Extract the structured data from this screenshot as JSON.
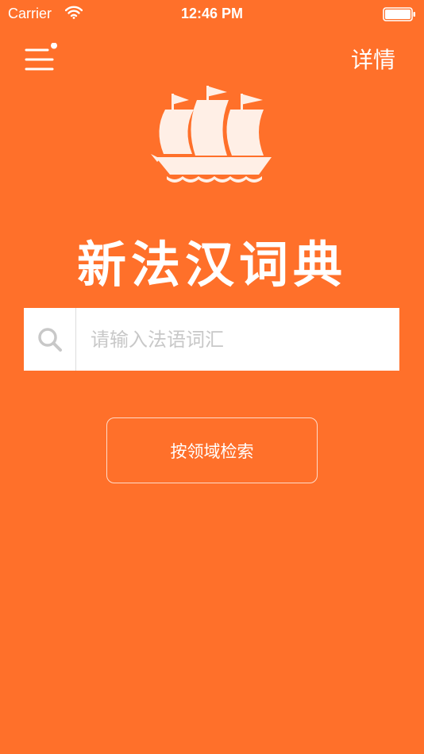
{
  "status_bar": {
    "carrier": "Carrier",
    "time": "12:46 PM",
    "wifi_icon": "wifi-icon",
    "battery_icon": "battery-icon"
  },
  "header": {
    "menu_icon": "menu-icon",
    "detail_label": "详情"
  },
  "logo": {
    "icon": "sailing-ship-icon"
  },
  "app_title": "新法汉词典",
  "search": {
    "icon": "search-icon",
    "placeholder": "请输入法语词汇",
    "value": ""
  },
  "domain_search": {
    "label": "按领域检索"
  },
  "colors": {
    "background": "#FF702A",
    "logo_fill": "#FFEFE6",
    "search_box": "#FFFFFF",
    "placeholder": "#C8C8C8"
  }
}
